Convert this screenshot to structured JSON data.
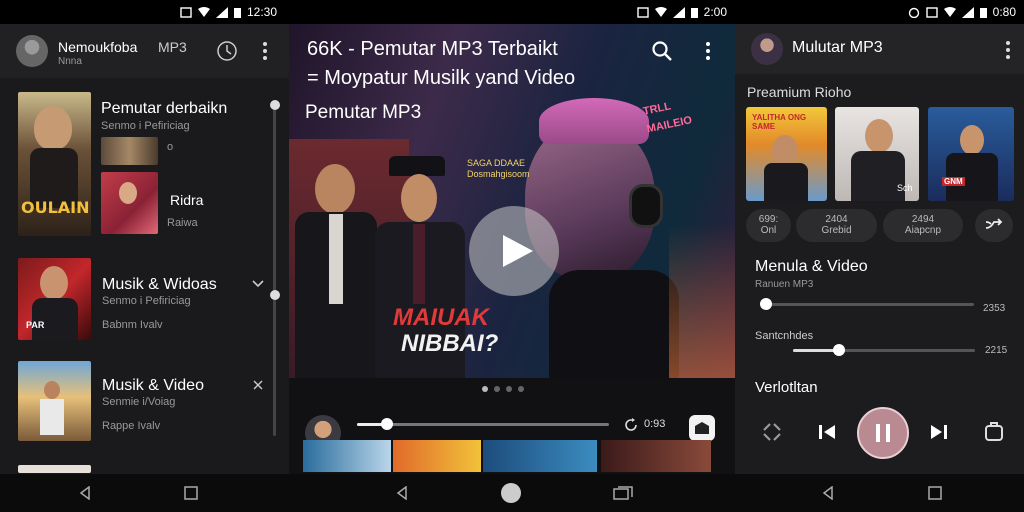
{
  "status_bars": [
    {
      "time": "12:30"
    },
    {
      "time": "2:00"
    },
    {
      "time": "0:80"
    }
  ],
  "panel1": {
    "header": {
      "title": "Nemoukfoba",
      "subtitle": "Nnna",
      "tab": "MP3"
    },
    "items": [
      {
        "title": "Pemutar derbaikn",
        "subtitle": "Senmo i Pefiriciag",
        "extra": "Ridra",
        "extra_sub": "Raiwa",
        "marker": "o"
      },
      {
        "title": "Musik & Widoas",
        "subtitle": "Senmo i Pefiriciag",
        "detail": "Babnm Ivalv"
      },
      {
        "title": "Musik & Video",
        "subtitle": "Senmie i/Voiag",
        "detail": "Rappe Ivalv"
      }
    ],
    "thumb_text": [
      "OULAIN",
      "PAR"
    ]
  },
  "panel2": {
    "title_line1": "66K - Pemutar MP3 Terbaikt",
    "title_line2": "= Moypatur Musilk yand Video",
    "title_line3": "Pemutar MP3",
    "poster_text": [
      "MAIUAK",
      "NIBBAI?"
    ],
    "neon_text": "TRLL MAILEIO",
    "poster_caption": [
      "SAGA DDAAE",
      "Dosmahgisoom"
    ],
    "progress": 0.12,
    "time_label": "0:93",
    "page_index": 0,
    "page_count": 4
  },
  "panel3": {
    "header": {
      "title": "Mulutar MP3"
    },
    "section_title": "Preamium Rioho",
    "cards": [
      {
        "label": "YALITHA ONG SAME"
      },
      {
        "label": "Sch"
      },
      {
        "label": "GNM"
      }
    ],
    "chips": [
      {
        "line1": "699:",
        "line2": "Onl"
      },
      {
        "line1": "2404",
        "line2": "Grebid"
      },
      {
        "line1": "2494",
        "line2": "Aiapcnp"
      }
    ],
    "media": {
      "title": "Menula & Video",
      "subtitle": "Ranuen MP3",
      "value": 0.02,
      "value_label": "2353"
    },
    "setting": {
      "title": "Santcnhdes",
      "value": 0.25,
      "value_label": "2215"
    },
    "footer_title": "Verlotltan",
    "colors": {
      "pause_button": "#b98a92"
    }
  }
}
